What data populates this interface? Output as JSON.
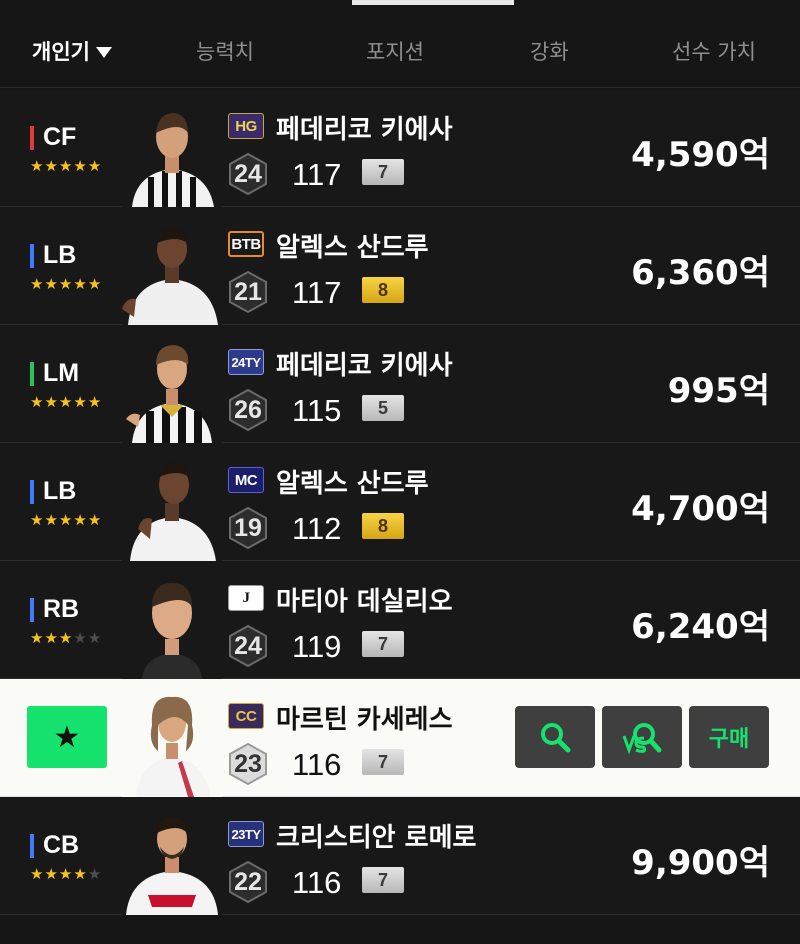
{
  "header": {
    "tabs": [
      {
        "label": "개인기",
        "active": true
      },
      {
        "label": "능력치",
        "active": false
      },
      {
        "label": "포지션",
        "active": false
      },
      {
        "label": "강화",
        "active": false
      },
      {
        "label": "선수 가치",
        "active": false
      }
    ]
  },
  "colors": {
    "accent": "#16e36e",
    "attacker": "#e23a3a",
    "defender": "#3c7bff",
    "midfielder": "#2dbf5a",
    "star": "#f7c21d"
  },
  "players": [
    {
      "position": "CF",
      "stars": 5,
      "season": "HG",
      "name": "페데리코 키에사",
      "level": "24",
      "overall": "117",
      "grade": "7",
      "price": "4,590억"
    },
    {
      "position": "LB",
      "stars": 5,
      "season": "BTB",
      "name": "알렉스 산드루",
      "level": "21",
      "overall": "117",
      "grade": "8",
      "price": "6,360억"
    },
    {
      "position": "LM",
      "stars": 5,
      "season": "24TY",
      "name": "페데리코 키에사",
      "level": "26",
      "overall": "115",
      "grade": "5",
      "price": "995억"
    },
    {
      "position": "LB",
      "stars": 5,
      "season": "MC",
      "name": "알렉스 산드루",
      "level": "19",
      "overall": "112",
      "grade": "8",
      "price": "4,700억"
    },
    {
      "position": "RB",
      "stars": 3,
      "season": "J",
      "name": "마티아 데실리오",
      "level": "24",
      "overall": "119",
      "grade": "7",
      "price": "6,240억"
    },
    {
      "position": "",
      "stars": 0,
      "season": "CC",
      "name": "마르틴 카세레스",
      "level": "23",
      "overall": "116",
      "grade": "7",
      "price": ""
    },
    {
      "position": "CB",
      "stars": 4,
      "season": "23TY",
      "name": "크리스티안 로메로",
      "level": "22",
      "overall": "116",
      "grade": "7",
      "price": "9,900억"
    }
  ],
  "selected_actions": {
    "favorite_symbol": "★",
    "search_icon": "search-icon",
    "compare_icon": "vs-compare-icon",
    "buy_label": "구매"
  }
}
